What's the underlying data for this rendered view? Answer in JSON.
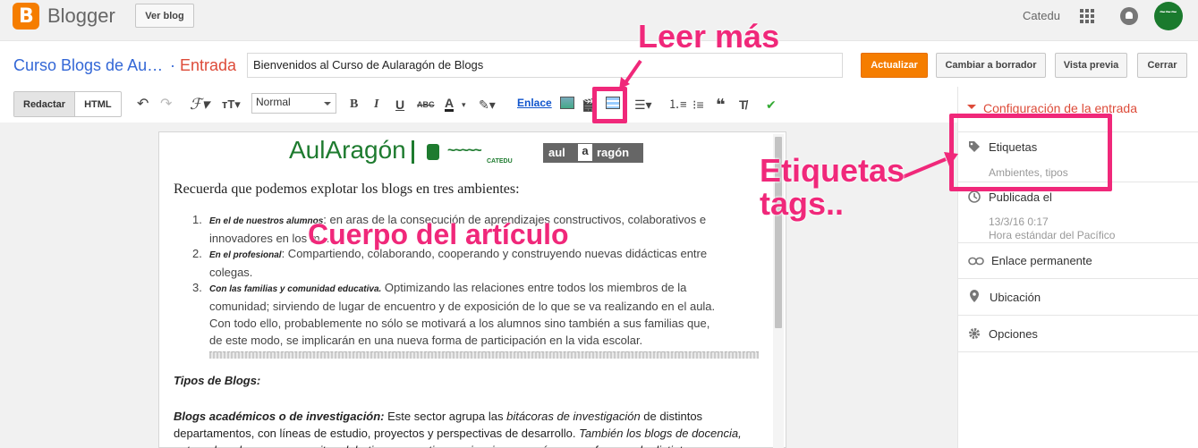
{
  "topbar": {
    "logo_letter": "B",
    "app_name": "Blogger",
    "view_blog": "Ver blog",
    "user": "Catedu"
  },
  "post_header": {
    "blog_title": "Curso Blogs de Au…",
    "separator": "·",
    "section": "Entrada",
    "title_value": "Bienvenidos al Curso de Aularagón de Blogs",
    "update": "Actualizar",
    "revert_draft": "Cambiar a borrador",
    "preview": "Vista previa",
    "close": "Cerrar"
  },
  "toolbar": {
    "compose": "Redactar",
    "html": "HTML",
    "format": "Normal",
    "bold": "B",
    "italic": "I",
    "underline": "U",
    "strike": "ABC",
    "text_color": "A",
    "link": "Enlace"
  },
  "editor": {
    "brand1": "AulAragón",
    "brand1_wave": "~~~~~",
    "brand1_sub": "CATEDU",
    "brand2_a": "aul",
    "brand2_b": "a",
    "brand2_c": "ragón",
    "intro": "Recuerda que podemos explotar los blogs en tres ambientes:",
    "list": [
      {
        "num": "1.",
        "lead": "En el de nuestros alumnos",
        "rest": ": en aras de la consecución de aprendizajes constructivos, colaborativos e innovadores en los m..."
      },
      {
        "num": "2.",
        "lead": "En el profesional",
        "rest": ": Compartiendo, colaborando, cooperando y construyendo nuevas didácticas entre colegas."
      },
      {
        "num": "3.",
        "lead": "Con las familias y comunidad educativa.",
        "rest": " Optimizando las relaciones entre todos los miembros de la comunidad; sirviendo de lugar de encuentro y de exposición de lo que se va realizando en el aula. Con todo ello, probablemente no sólo se motivará a los alumnos sino también a sus familias que, de este modo, se implicarán en una nueva forma de participación en la vida escolar."
      }
    ],
    "types_heading": "Tipos de Blogs:",
    "academic_lead": "Blogs académicos o de investigación:",
    "academic_text1": " Este sector agrupa las ",
    "academic_em1": "bitácoras de investigación",
    "academic_text2": " de distintos departamentos, con líneas de estudio, proyectos y perspectivas de desarrollo. ",
    "academic_em2": "También los blogs de docencia, entre educadores, que permiten debatir y compartir experiencias en su área o profesores de distintos"
  },
  "sidebar": {
    "header": "Configuración de la entrada",
    "labels_title": "Etiquetas",
    "labels_value": "Ambientes, tipos",
    "published_title": "Publicada el",
    "published_date": "13/3/16 0:17",
    "published_tz": "Hora estándar del Pacífico",
    "permalink": "Enlace permanente",
    "location": "Ubicación",
    "options": "Opciones"
  },
  "annotations": {
    "read_more": "Leer más",
    "labels_line1": "Etiquetas",
    "labels_line2": "tags..",
    "body": "Cuerpo del artículo"
  },
  "colors": {
    "accent": "#f57d00",
    "annotation": "#f0287a",
    "link_blue": "#3367d6"
  }
}
